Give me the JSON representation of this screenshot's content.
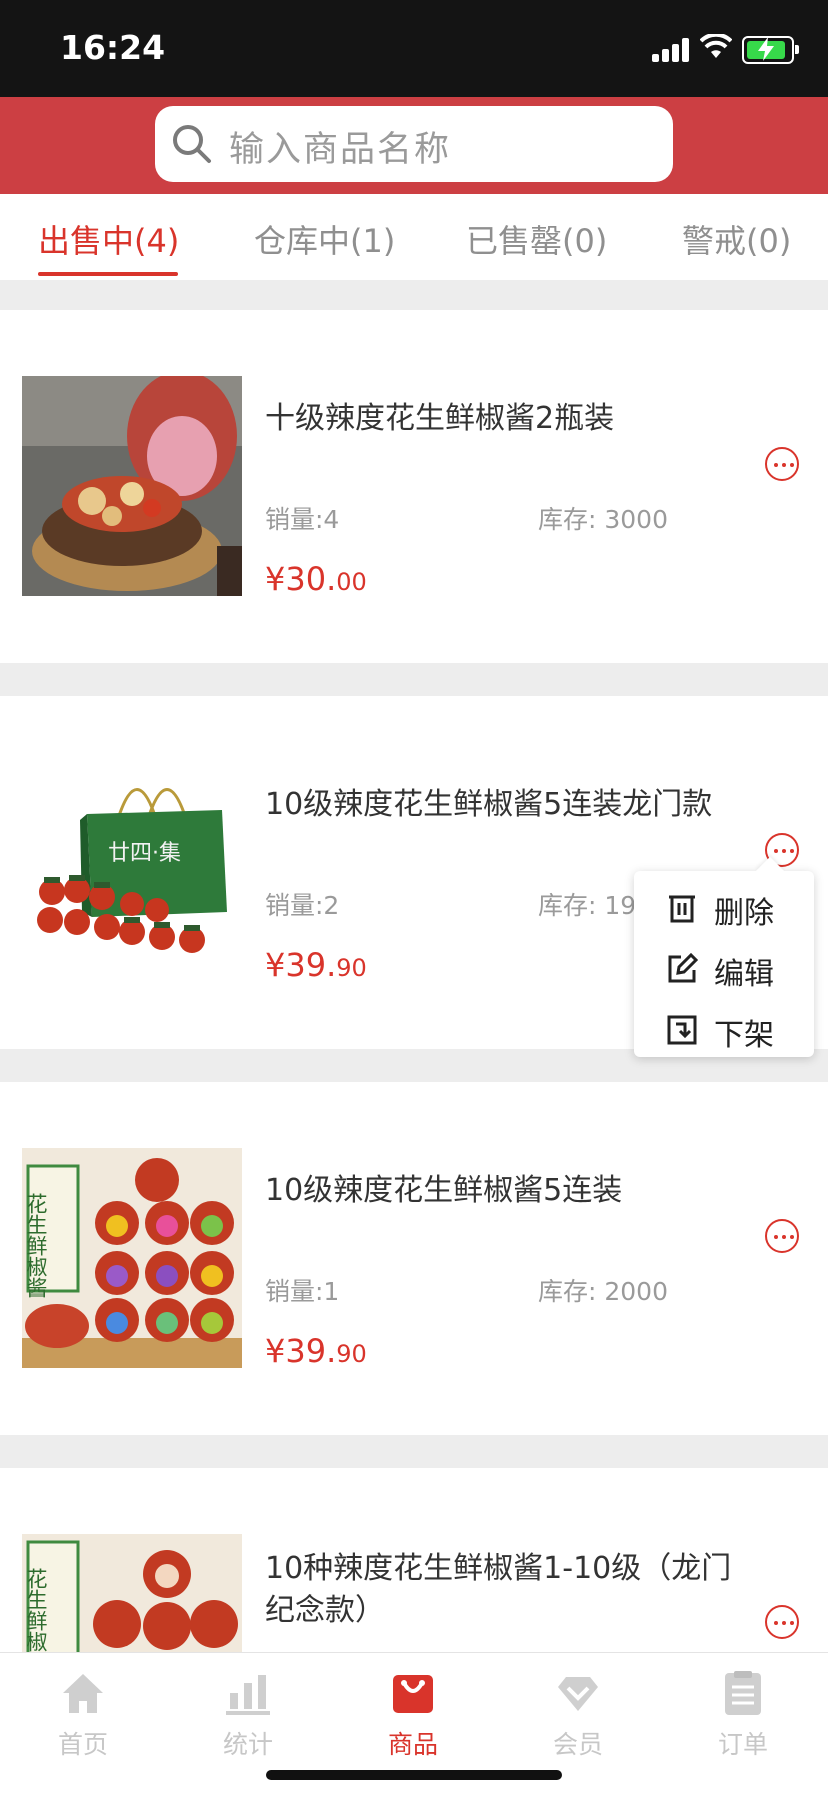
{
  "status": {
    "time": "16:24"
  },
  "search": {
    "placeholder": "输入商品名称"
  },
  "tabs": [
    {
      "label": "出售中(4)",
      "active": true
    },
    {
      "label": "仓库中(1)",
      "active": false
    },
    {
      "label": "已售罄(0)",
      "active": false
    },
    {
      "label": "警戒(0)",
      "active": false
    }
  ],
  "products": [
    {
      "title": "十级辣度花生鲜椒酱2瓶装",
      "sales": "销量:4",
      "stock": "库存: 3000",
      "price_int": "¥30.",
      "price_dec": "00"
    },
    {
      "title": "10级辣度花生鲜椒酱5连装龙门款",
      "sales": "销量:2",
      "stock": "库存: 19",
      "price_int": "¥39.",
      "price_dec": "90"
    },
    {
      "title": "10级辣度花生鲜椒酱5连装",
      "sales": "销量:1",
      "stock": "库存: 2000",
      "price_int": "¥39.",
      "price_dec": "90"
    },
    {
      "title": "10种辣度花生鲜椒酱1-10级（龙门纪念款）"
    }
  ],
  "product_images": [
    {
      "jar_text": ""
    },
    {
      "bag_text": "廿四·集"
    },
    {
      "label_text": "花生鲜椒酱"
    },
    {
      "label_text": "花生鲜椒酱"
    }
  ],
  "menu": {
    "delete": "删除",
    "edit": "编辑",
    "offshelf": "下架"
  },
  "tabbar": [
    {
      "label": "首页",
      "icon": "home-icon"
    },
    {
      "label": "统计",
      "icon": "chart-icon"
    },
    {
      "label": "商品",
      "icon": "bag-icon",
      "active": true
    },
    {
      "label": "会员",
      "icon": "diamond-icon"
    },
    {
      "label": "订单",
      "icon": "order-icon"
    }
  ],
  "colors": {
    "accent": "#d9342b",
    "header": "#cc3f43"
  }
}
